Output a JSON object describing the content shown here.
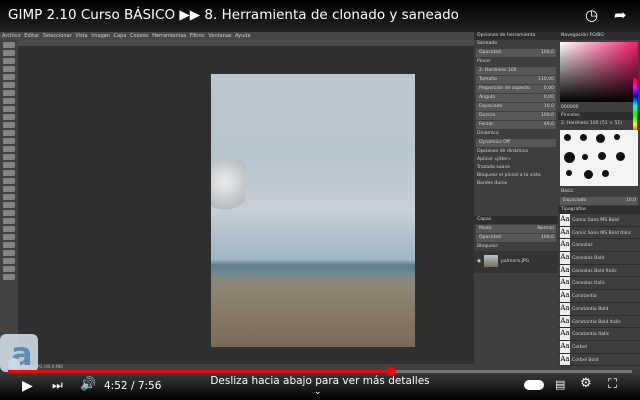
{
  "video": {
    "title": "GIMP 2.10 Curso BÁSICO ▶▶ 8. Herramienta de clonado y saneado",
    "current_time": "4:52",
    "duration": "7:56",
    "time_separator": "/",
    "progress_fraction": 0.613,
    "hint": "Desliza hacia abajo para ver más detalles",
    "accent": "#ff0000"
  },
  "gimp": {
    "menubar": [
      "Archivo",
      "Editar",
      "Seleccionar",
      "Vista",
      "Imagen",
      "Capa",
      "Colores",
      "Herramientas",
      "Filtros",
      "Ventanas",
      "Ayuda"
    ],
    "status": "palmera.JPG (40,0 MB)",
    "tool_options": {
      "header": "Opciones de herramienta",
      "tool": "Saneado",
      "rows": [
        {
          "label": "Opacidad",
          "value": "100,0"
        },
        {
          "label": "Pincel",
          "value": ""
        },
        {
          "label": "2. Hardness 100",
          "value": ""
        },
        {
          "label": "Tamaño",
          "value": "110,00"
        },
        {
          "label": "Proporción de aspecto",
          "value": "0,00"
        },
        {
          "label": "Ángulo",
          "value": "0,00"
        },
        {
          "label": "Espaciado",
          "value": "10,0"
        },
        {
          "label": "Dureza",
          "value": "100,0"
        },
        {
          "label": "Forzar",
          "value": "49,6"
        }
      ],
      "dynamics_label": "Dinámica",
      "dynamics_value": "Dynamics Off",
      "options": [
        "Opciones de dinámica",
        "Aplicar «jitter»",
        "Trazado suave",
        "Bloquear el pincel a la vista",
        "Bordes duros"
      ]
    },
    "layers": {
      "header": "Capas",
      "mode_label": "Modo",
      "mode_value": "Normal",
      "opacity_label": "Opacidad",
      "opacity_value": "100,0",
      "lock_label": "Bloquear:",
      "layer_name": "palmera.JPG"
    },
    "color": {
      "header": "Navegación",
      "tab2": "FG/BG",
      "hex": "000000"
    },
    "brushes": {
      "header": "Pinceles",
      "current": "2. Hardness 100 (51 × 51)",
      "tag": "Básic.",
      "spacing_label": "Espaciado",
      "spacing_value": "10,0"
    },
    "fonts": {
      "header": "Tipografías",
      "glyph": "Aa",
      "items": [
        "Comic Sans MS Bold",
        "Comic Sans MS Bold Italic",
        "Consolas",
        "Consolas Bold",
        "Consolas Bold Italic",
        "Consolas Italic",
        "Constantia",
        "Constantia Bold",
        "Constantia Bold Italic",
        "Constantia Italic",
        "Corbel",
        "Corbel Bold"
      ]
    }
  }
}
